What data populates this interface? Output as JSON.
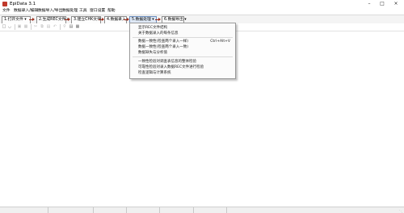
{
  "window": {
    "title": "EpiData 3.1",
    "minimize_icon": "minimize-icon",
    "maximize_icon": "maximize-icon",
    "close_icon": "close-icon"
  },
  "menubar": {
    "items": [
      "文件",
      "数据录入/编辑",
      "数据导入/导出",
      "数据处理",
      "工具",
      "窗口设置",
      "帮助"
    ]
  },
  "stepbar": {
    "steps": [
      "1.打开文件 ▾",
      "2.生成REC文件 ▾",
      "3.建立CHK文件",
      "4.数据录入",
      "5.数据处理 ▾",
      "6.数据导出 ▾"
    ],
    "active_index": 4
  },
  "toolbar": {
    "icons": [
      "new-file-icon",
      "open-folder-icon",
      "save-icon",
      "print-icon",
      "cut-icon",
      "copy-icon",
      "paste-icon",
      "undo-icon",
      "find-icon",
      "doc-icon",
      "form-icon"
    ]
  },
  "dropdown": {
    "groups": [
      [
        "显示REC文件结构",
        "关于数据录入的每条信息"
      ],
      [
        "数据一致性(检查两个录入一样)",
        "数据一致性(检查两个录入一致)",
        "数据缺失与分析值"
      ],
      [
        "一致性检验对调查表信息的整体检验",
        "可靠性检验对录入数据REC文件进行检验",
        "检查逻辑与计算系统"
      ]
    ],
    "shortcut": "Ctrl+Alt+V"
  },
  "status": {
    "cells": [
      "",
      "",
      "",
      "",
      "",
      ""
    ]
  }
}
